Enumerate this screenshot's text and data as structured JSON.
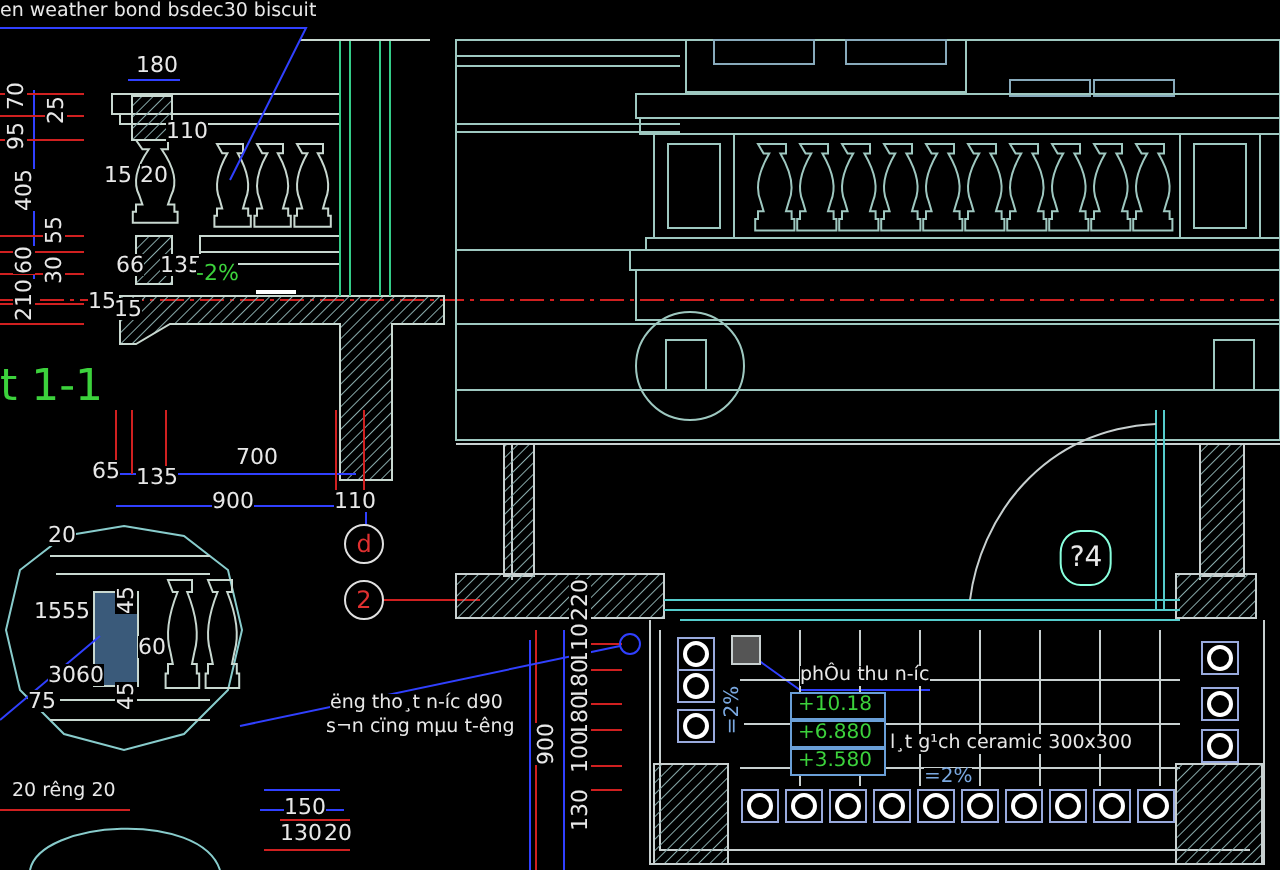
{
  "drawing": {
    "labels": [
      {
        "text": "en weather bond bsdec30 biscuit",
        "kind": "note"
      },
      {
        "text": "180",
        "kind": "dim"
      },
      {
        "text": "70",
        "kind": "vdim"
      },
      {
        "text": "25",
        "kind": "vdim"
      },
      {
        "text": "95",
        "kind": "vdim"
      },
      {
        "text": "110",
        "kind": "dim"
      },
      {
        "text": "405",
        "kind": "vdim"
      },
      {
        "text": "15",
        "kind": "dim"
      },
      {
        "text": "20",
        "kind": "dim"
      },
      {
        "text": "55",
        "kind": "vdim"
      },
      {
        "text": "60",
        "kind": "vdim"
      },
      {
        "text": "30",
        "kind": "vdim"
      },
      {
        "text": "210",
        "kind": "vdim"
      },
      {
        "text": "66",
        "kind": "dim"
      },
      {
        "text": "135",
        "kind": "dim"
      },
      {
        "text": "-2%",
        "kind": "grade"
      },
      {
        "text": "15",
        "kind": "dim"
      },
      {
        "text": "15",
        "kind": "dim"
      },
      {
        "text": "t 1-1",
        "kind": "title"
      },
      {
        "text": "65",
        "kind": "dim"
      },
      {
        "text": "135",
        "kind": "dim"
      },
      {
        "text": "700",
        "kind": "dim"
      },
      {
        "text": "900",
        "kind": "dim"
      },
      {
        "text": "110",
        "kind": "dim"
      },
      {
        "text": "d",
        "kind": "axis"
      },
      {
        "text": "2",
        "kind": "axis"
      },
      {
        "text": "20",
        "kind": "dim"
      },
      {
        "text": "1555",
        "kind": "dim"
      },
      {
        "text": "45",
        "kind": "vdim"
      },
      {
        "text": "60",
        "kind": "dim"
      },
      {
        "text": "3060",
        "kind": "dim"
      },
      {
        "text": "75",
        "kind": "dim"
      },
      {
        "text": "45",
        "kind": "vdim"
      },
      {
        "text": "ëng tho¸t n-íc d90",
        "kind": "note"
      },
      {
        "text": "s¬n cïng mµu t-êng",
        "kind": "note"
      },
      {
        "text": "900",
        "kind": "vdim"
      },
      {
        "text": "220",
        "kind": "vdim"
      },
      {
        "text": "110",
        "kind": "vdim"
      },
      {
        "text": "180",
        "kind": "vdim"
      },
      {
        "text": "180",
        "kind": "vdim"
      },
      {
        "text": "100",
        "kind": "vdim"
      },
      {
        "text": "130",
        "kind": "vdim"
      },
      {
        "text": "20 rêng 20",
        "kind": "note"
      },
      {
        "text": "150",
        "kind": "dim"
      },
      {
        "text": "130",
        "kind": "dim"
      },
      {
        "text": "20",
        "kind": "dim"
      },
      {
        "text": "phÔu thu n-íc",
        "kind": "note"
      },
      {
        "text": "+10.18",
        "kind": "level"
      },
      {
        "text": "+6.880",
        "kind": "level"
      },
      {
        "text": "+3.580",
        "kind": "level"
      },
      {
        "text": "=2%",
        "kind": "vslope"
      },
      {
        "text": "l¸t g¹ch ceramic 300x300",
        "kind": "note"
      },
      {
        "text": "=2%",
        "kind": "slope"
      },
      {
        "text": "?4",
        "kind": "room"
      }
    ]
  }
}
